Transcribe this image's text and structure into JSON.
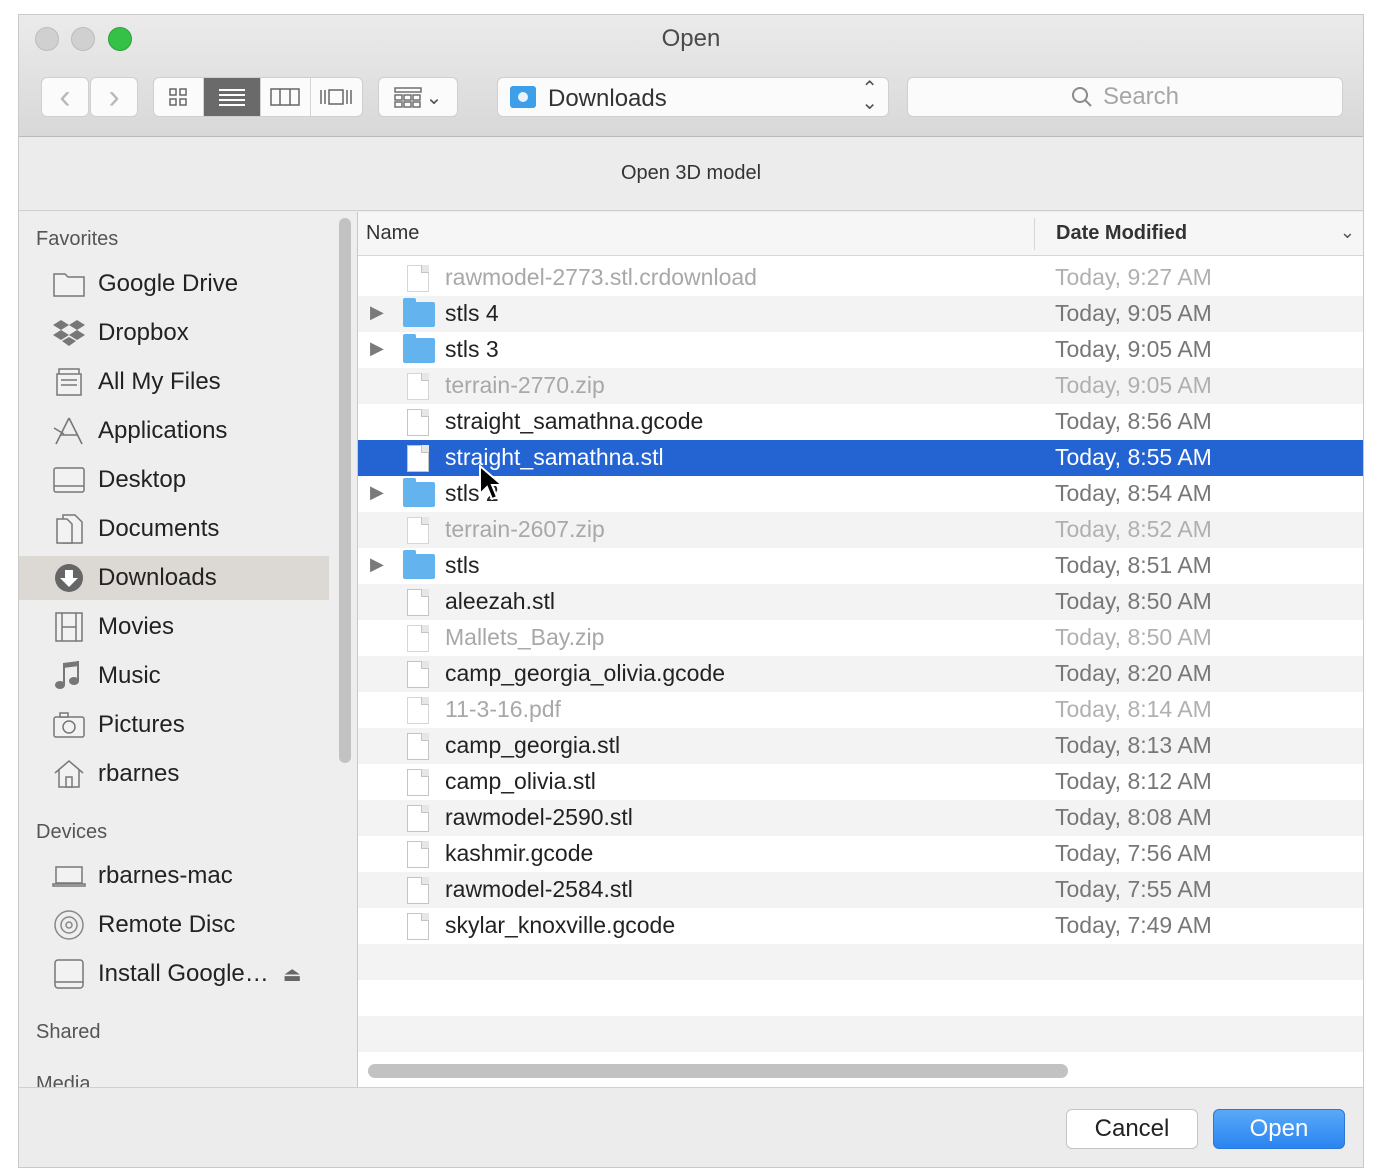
{
  "window": {
    "title": "Open",
    "message": "Open 3D model"
  },
  "toolbar": {
    "back_glyph": "‹",
    "forward_glyph": "›",
    "view_modes": [
      "icon-view",
      "list-view",
      "column-view",
      "cover-flow-view"
    ],
    "active_view": "list-view",
    "arrange_glyph": "⌄",
    "location": "Downloads",
    "search_placeholder": "Search"
  },
  "sidebar": {
    "favorites_label": "Favorites",
    "favorites": [
      {
        "label": "Google Drive",
        "icon": "folder-icon"
      },
      {
        "label": "Dropbox",
        "icon": "dropbox-icon"
      },
      {
        "label": "All My Files",
        "icon": "all-files-icon"
      },
      {
        "label": "Applications",
        "icon": "applications-icon"
      },
      {
        "label": "Desktop",
        "icon": "desktop-icon"
      },
      {
        "label": "Documents",
        "icon": "documents-icon"
      },
      {
        "label": "Downloads",
        "icon": "downloads-icon",
        "selected": true
      },
      {
        "label": "Movies",
        "icon": "movies-icon"
      },
      {
        "label": "Music",
        "icon": "music-icon"
      },
      {
        "label": "Pictures",
        "icon": "pictures-icon"
      },
      {
        "label": "rbarnes",
        "icon": "home-icon"
      }
    ],
    "devices_label": "Devices",
    "devices": [
      {
        "label": "rbarnes-mac",
        "icon": "laptop-icon"
      },
      {
        "label": "Remote Disc",
        "icon": "disc-icon"
      },
      {
        "label": "Install Google…",
        "icon": "drive-icon",
        "eject": "⏏"
      }
    ],
    "shared_label": "Shared",
    "media_label": "Media"
  },
  "columns": {
    "name": "Name",
    "date": "Date Modified"
  },
  "files": [
    {
      "name": "rawmodel-2773.stl.crdownload",
      "date": "Today, 9:27 AM",
      "kind": "file",
      "dim": true
    },
    {
      "name": "stls 4",
      "date": "Today, 9:05 AM",
      "kind": "folder"
    },
    {
      "name": "stls 3",
      "date": "Today, 9:05 AM",
      "kind": "folder"
    },
    {
      "name": "terrain-2770.zip",
      "date": "Today, 9:05 AM",
      "kind": "zip",
      "dim": true
    },
    {
      "name": "straight_samathna.gcode",
      "date": "Today, 8:56 AM",
      "kind": "file"
    },
    {
      "name": "straight_samathna.stl",
      "date": "Today, 8:55 AM",
      "kind": "file",
      "selected": true
    },
    {
      "name": "stls 2",
      "date": "Today, 8:54 AM",
      "kind": "folder"
    },
    {
      "name": "terrain-2607.zip",
      "date": "Today, 8:52 AM",
      "kind": "zip",
      "dim": true
    },
    {
      "name": "stls",
      "date": "Today, 8:51 AM",
      "kind": "folder"
    },
    {
      "name": "aleezah.stl",
      "date": "Today, 8:50 AM",
      "kind": "file"
    },
    {
      "name": "Mallets_Bay.zip",
      "date": "Today, 8:50 AM",
      "kind": "zip",
      "dim": true
    },
    {
      "name": "camp_georgia_olivia.gcode",
      "date": "Today, 8:20 AM",
      "kind": "file"
    },
    {
      "name": "11-3-16.pdf",
      "date": "Today, 8:14 AM",
      "kind": "pdf",
      "dim": true
    },
    {
      "name": "camp_georgia.stl",
      "date": "Today, 8:13 AM",
      "kind": "file"
    },
    {
      "name": "camp_olivia.stl",
      "date": "Today, 8:12 AM",
      "kind": "file"
    },
    {
      "name": "rawmodel-2590.stl",
      "date": "Today, 8:08 AM",
      "kind": "file"
    },
    {
      "name": "kashmir.gcode",
      "date": "Today, 7:56 AM",
      "kind": "file"
    },
    {
      "name": "rawmodel-2584.stl",
      "date": "Today, 7:55 AM",
      "kind": "file"
    },
    {
      "name": "skylar_knoxville.gcode",
      "date": "Today, 7:49 AM",
      "kind": "file"
    }
  ],
  "buttons": {
    "cancel": "Cancel",
    "open": "Open"
  },
  "colors": {
    "selection": "#2463d2",
    "accent": "#2a84f0",
    "folder": "#63b4ee",
    "close_active": "#35c048"
  }
}
